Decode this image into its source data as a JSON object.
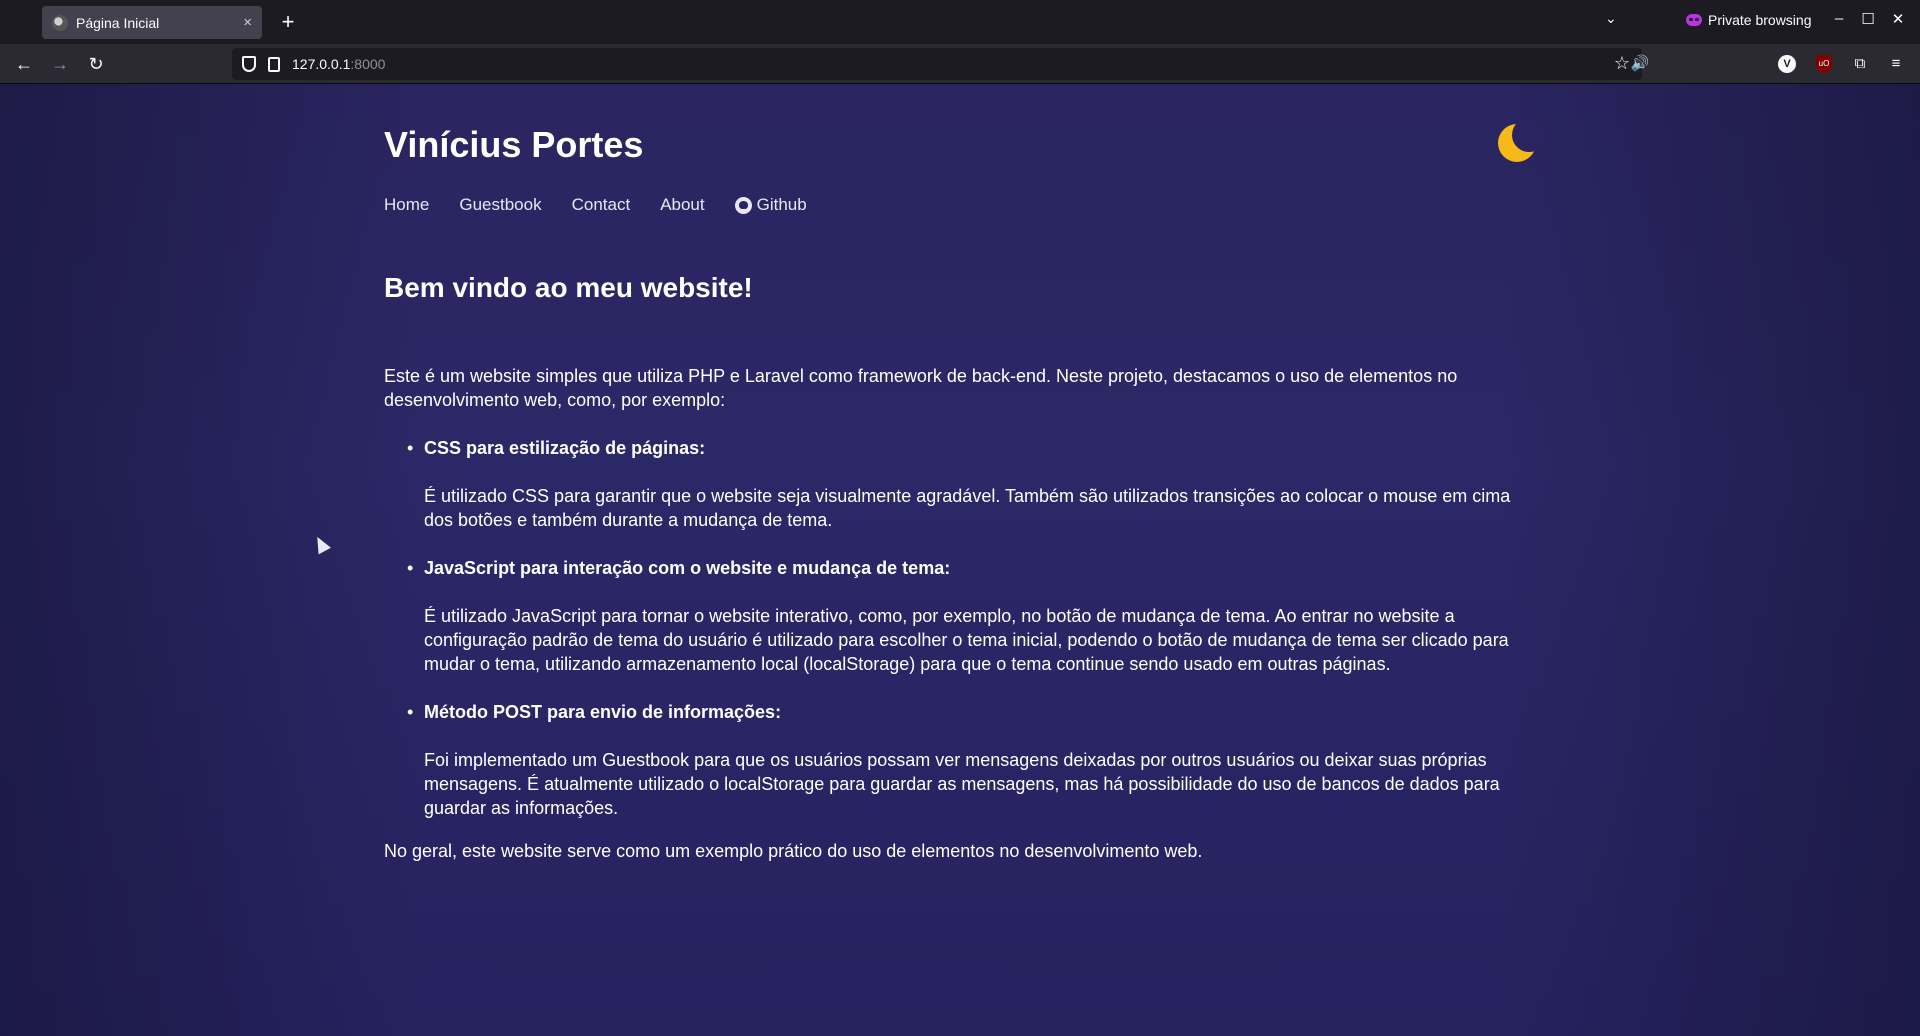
{
  "browser": {
    "tab_title": "Página Inicial",
    "tab_close": "×",
    "new_tab": "+",
    "tab_list_icon": "⌄",
    "private_label": "Private browsing",
    "minimize": "–",
    "maximize": "☐",
    "close": "✕",
    "back": "←",
    "forward": "→",
    "reload": "↻",
    "url_host": "127.0.0.1",
    "url_port": ":8000",
    "bookmark": "☆",
    "reader": "🔊",
    "ext_v": "V",
    "ext_ub": "uO",
    "extensions": "⧉",
    "menu": "≡"
  },
  "site": {
    "title": "Vinícius Portes",
    "nav": [
      "Home",
      "Guestbook",
      "Contact",
      "About",
      "Github"
    ]
  },
  "main": {
    "heading": "Bem vindo ao meu website!",
    "intro": "Este é um website simples que utiliza PHP e Laravel como framework de back-end. Neste projeto, destacamos o uso de elementos no desenvolvimento web, como, por exemplo:",
    "items": [
      {
        "title": "CSS para estilização de páginas:",
        "desc": "É utilizado CSS para garantir que o website seja visualmente agradável. Também são utilizados transições ao colocar o mouse em cima dos botões e também durante a mudança de tema."
      },
      {
        "title": "JavaScript para interação com o website e mudança de tema:",
        "desc": "É utilizado JavaScript para tornar o website interativo, como, por exemplo, no botão de mudança de tema. Ao entrar no website a configuração padrão de tema do usuário é utilizado para escolher o tema inicial, podendo o botão de mudança de tema ser clicado para mudar o tema, utilizando armazenamento local (localStorage) para que o tema continue sendo usado em outras páginas."
      },
      {
        "title": "Método POST para envio de informações:",
        "desc": "Foi implementado um Guestbook para que os usuários possam ver mensagens deixadas por outros usuários ou deixar suas próprias mensagens. É atualmente utilizado o localStorage para guardar as mensagens, mas há possibilidade do uso de bancos de dados para guardar as informações."
      }
    ],
    "outro": "No geral, este website serve como um exemplo prático do uso de elementos no desenvolvimento web."
  },
  "colors": {
    "background": "#2a2560",
    "moon": "#f6b91a",
    "text": "#ffffff"
  },
  "icons": {
    "theme_toggle": "moon-icon",
    "github": "github-icon"
  }
}
